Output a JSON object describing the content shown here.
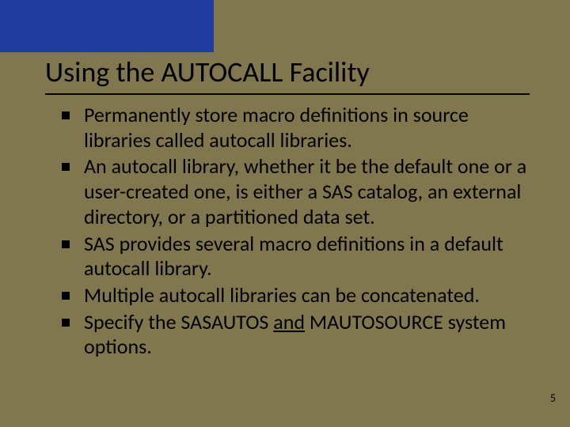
{
  "slide": {
    "title": "Using the AUTOCALL Facility",
    "bullets": [
      {
        "text": "Permanently store macro definitions in source libraries called autocall libraries."
      },
      {
        "text": "An autocall library, whether it be the default one or a user-created one, is either a SAS catalog, an external directory, or a partitioned data set."
      },
      {
        "text": "SAS provides several macro definitions in a default autocall library."
      },
      {
        "text": "Multiple autocall libraries can be concatenated."
      },
      {
        "pre": "Specify the SASAUTOS ",
        "underline": "and",
        "post": " MAUTOSOURCE system options."
      }
    ],
    "page_number": "5"
  }
}
